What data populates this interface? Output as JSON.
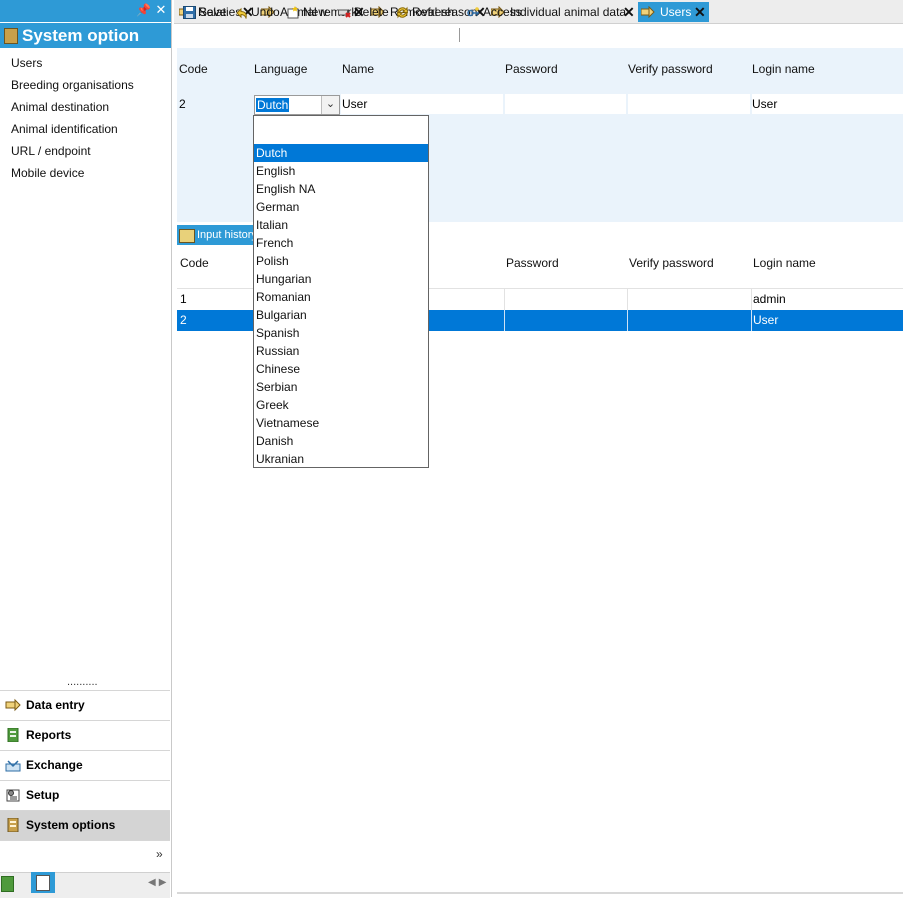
{
  "panel": {
    "title": "System option",
    "nav_items": [
      "Users",
      "Breeding organisations",
      "Animal destination",
      "Animal identification",
      "URL / endpoint",
      "Mobile device"
    ],
    "categories": [
      {
        "label": "Data entry",
        "icon": "data-entry-icon"
      },
      {
        "label": "Reports",
        "icon": "reports-icon"
      },
      {
        "label": "Exchange",
        "icon": "exchange-icon"
      },
      {
        "label": "Setup",
        "icon": "setup-icon"
      },
      {
        "label": "System options",
        "icon": "system-options-icon"
      }
    ],
    "active_category": "System options"
  },
  "tabs": [
    {
      "label": "Relaties",
      "active": false
    },
    {
      "label": "Animal remark",
      "active": false
    },
    {
      "label": "Removal reason",
      "active": false
    },
    {
      "label": "Individual animal data",
      "active": false
    },
    {
      "label": "Users",
      "active": true
    }
  ],
  "toolbar": {
    "save": "Save",
    "undo": "Undo",
    "new": "New",
    "delete": "Delete",
    "refresh": "Refresh",
    "access": "Access"
  },
  "editor": {
    "headers": {
      "code": "Code",
      "language": "Language",
      "name": "Name",
      "password": "Password",
      "verify": "Verify password",
      "login": "Login name"
    },
    "row": {
      "code": "2",
      "language": "Dutch",
      "name": "User",
      "password": "",
      "verify": "",
      "login": "User"
    }
  },
  "language_options": [
    "Dutch",
    "English",
    "English NA",
    "German",
    "Italian",
    "French",
    "Polish",
    "Hungarian",
    "Romanian",
    "Bulgarian",
    "Spanish",
    "Russian",
    "Chinese",
    "Serbian",
    "Greek",
    "Vietnamese",
    "Danish",
    "Ukranian"
  ],
  "selected_language": "Dutch",
  "history": {
    "tab_label": "Input history",
    "headers": {
      "code": "Code",
      "password": "Password",
      "verify": "Verify password",
      "login": "Login name"
    },
    "rows": [
      {
        "code": "1",
        "login": "admin",
        "selected": false
      },
      {
        "code": "2",
        "login": "User",
        "selected": true
      }
    ]
  },
  "colors": {
    "accent": "#2e9ad6",
    "selection": "#0078d7",
    "editor_bg": "#eaf3fb",
    "active_category_bg": "#d4d4d4"
  }
}
